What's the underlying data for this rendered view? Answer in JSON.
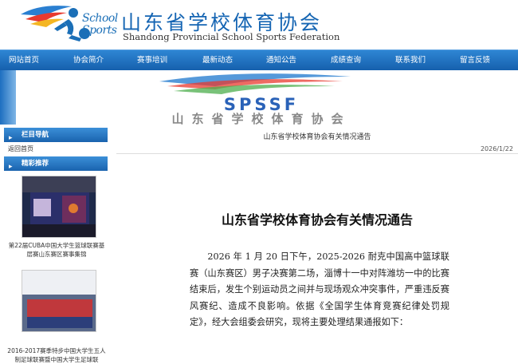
{
  "header": {
    "logo_school": "School",
    "logo_sports": "Sports",
    "title": "山东省学校体育协会",
    "subtitle": "Shandong Provincial School Sports Federation"
  },
  "nav": [
    "网站首页",
    "协会简介",
    "赛事培训",
    "最新动态",
    "通知公告",
    "成绩查询",
    "联系我们",
    "留言反馈"
  ],
  "banner": {
    "abbr": "SPSSF",
    "title": "山东省学校体育协会",
    "subtitle": "SHANDONG PROVINCIAL SCHOOL SPORTS FEDERATION"
  },
  "sidebar": {
    "nav_heading": "栏目导航",
    "back_link": "返回首页",
    "featured_heading": "精彩推荐",
    "items": [
      {
        "caption": "第22届CUBA中国大学生篮球联赛基层赛山东赛区赛事集锦"
      },
      {
        "caption": "2016-2017赛季特步中国大学生五人制足球联赛暨中国大学生足球联"
      }
    ]
  },
  "article": {
    "crumb_title": "山东省学校体育协会有关情况通告",
    "date": "2026/1/22",
    "title": "山东省学校体育协会有关情况通告",
    "body": "2026 年 1 月 20 日下午，2025-2026 耐克中国高中篮球联赛（山东赛区）男子决赛第二场，淄博十一中对阵潍坊一中的比赛结束后，发生个别运动员之间并与现场观众冲突事件，严重违反赛风赛纪、造成不良影响。依据《全国学生体育竞赛纪律处罚规定》，经大会组委会研究，现将主要处理结果通报如下："
  }
}
